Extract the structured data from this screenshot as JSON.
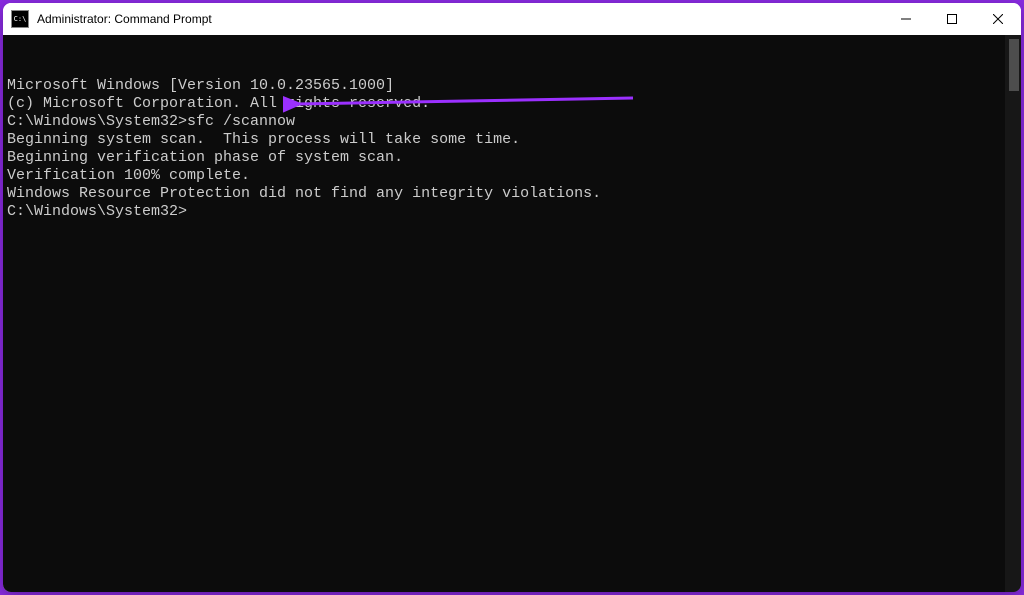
{
  "window": {
    "title": "Administrator: Command Prompt",
    "icon_label": "cmd-icon"
  },
  "console": {
    "lines": [
      "Microsoft Windows [Version 10.0.23565.1000]",
      "(c) Microsoft Corporation. All rights reserved.",
      "",
      "C:\\Windows\\System32>sfc /scannow",
      "",
      "Beginning system scan.  This process will take some time.",
      "",
      "Beginning verification phase of system scan.",
      "Verification 100% complete.",
      "",
      "Windows Resource Protection did not find any integrity violations.",
      "",
      "C:\\Windows\\System32>"
    ]
  },
  "annotation": {
    "arrow_color": "#9b30ff"
  }
}
